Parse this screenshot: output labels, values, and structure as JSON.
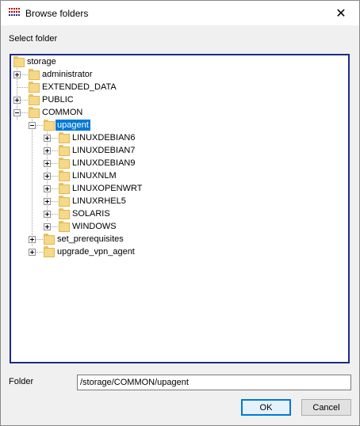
{
  "window": {
    "title": "Browse folders",
    "close_icon": "close-icon",
    "app_icon": "app-icon"
  },
  "select_folder_label": "Select folder",
  "tree": {
    "items": [
      {
        "label": "storage",
        "expanded": true
      },
      {
        "label": "administrator",
        "expander": "plus"
      },
      {
        "label": "EXTENDED_DATA"
      },
      {
        "label": "PUBLIC",
        "expander": "plus"
      },
      {
        "label": "COMMON",
        "expander": "minus"
      },
      {
        "label": "upagent",
        "expander": "minus",
        "selected": true
      },
      {
        "label": "LINUXDEBIAN6",
        "expander": "plus"
      },
      {
        "label": "LINUXDEBIAN7",
        "expander": "plus"
      },
      {
        "label": "LINUXDEBIAN9",
        "expander": "plus"
      },
      {
        "label": "LINUXNLM",
        "expander": "plus"
      },
      {
        "label": "LINUXOPENWRT",
        "expander": "plus"
      },
      {
        "label": "LINUXRHEL5",
        "expander": "plus"
      },
      {
        "label": "SOLARIS",
        "expander": "plus"
      },
      {
        "label": "WINDOWS",
        "expander": "plus"
      },
      {
        "label": "set_prerequisites",
        "expander": "plus"
      },
      {
        "label": "upgrade_vpn_agent",
        "expander": "plus"
      }
    ]
  },
  "folder_field": {
    "label": "Folder",
    "value": "/storage/COMMON/upagent"
  },
  "buttons": {
    "ok": "OK",
    "cancel": "Cancel"
  },
  "colors": {
    "selection": "#0078d7",
    "tree_border": "#1a2a8a",
    "folder": "#f6d889"
  }
}
